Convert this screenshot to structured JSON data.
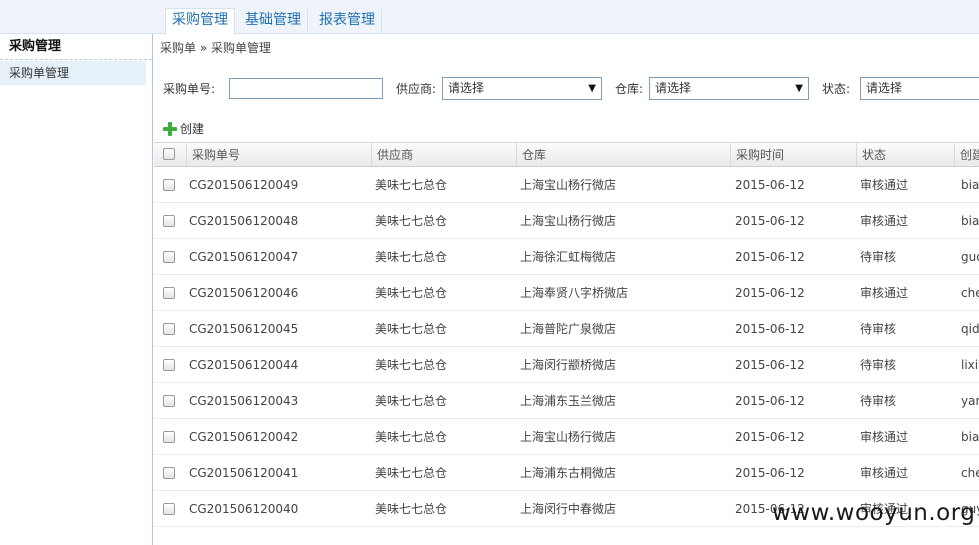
{
  "nav": {
    "tabs": [
      {
        "label": "采购管理",
        "active": true
      },
      {
        "label": "基础管理",
        "active": false
      },
      {
        "label": "报表管理",
        "active": false
      }
    ]
  },
  "sidebar": {
    "title": "采购管理",
    "items": [
      {
        "label": "采购单管理"
      }
    ]
  },
  "breadcrumb": "采购单 » 采购单管理",
  "filters": {
    "order_no_label": "采购单号:",
    "order_no_value": "",
    "supplier_label": "供应商:",
    "supplier_value": "请选择",
    "warehouse_label": "仓库:",
    "warehouse_value": "请选择",
    "status_label": "状态:",
    "status_value": "请选择"
  },
  "toolbar": {
    "create_label": "创建"
  },
  "table": {
    "headers": [
      "采购单号",
      "供应商",
      "仓库",
      "采购时间",
      "状态",
      "创建"
    ],
    "rows": [
      [
        "CG201506120049",
        "美味七七总仓",
        "上海宝山杨行微店",
        "2015-06-12",
        "审核通过",
        "bian"
      ],
      [
        "CG201506120048",
        "美味七七总仓",
        "上海宝山杨行微店",
        "2015-06-12",
        "审核通过",
        "bian"
      ],
      [
        "CG201506120047",
        "美味七七总仓",
        "上海徐汇虹梅微店",
        "2015-06-12",
        "待审核",
        "guo"
      ],
      [
        "CG201506120046",
        "美味七七总仓",
        "上海奉贤八字桥微店",
        "2015-06-12",
        "审核通过",
        "che"
      ],
      [
        "CG201506120045",
        "美味七七总仓",
        "上海普陀广泉微店",
        "2015-06-12",
        "待审核",
        "qid"
      ],
      [
        "CG201506120044",
        "美味七七总仓",
        "上海闵行颛桥微店",
        "2015-06-12",
        "待审核",
        "lixia"
      ],
      [
        "CG201506120043",
        "美味七七总仓",
        "上海浦东玉兰微店",
        "2015-06-12",
        "待审核",
        "yan"
      ],
      [
        "CG201506120042",
        "美味七七总仓",
        "上海宝山杨行微店",
        "2015-06-12",
        "审核通过",
        "bian"
      ],
      [
        "CG201506120041",
        "美味七七总仓",
        "上海浦东古桐微店",
        "2015-06-12",
        "审核通过",
        "che"
      ],
      [
        "CG201506120040",
        "美味七七总仓",
        "上海闵行中春微店",
        "2015-06-12",
        "审核通过",
        "guy"
      ]
    ]
  },
  "watermark": "www.wooyun.org",
  "colors": {
    "accent": "#1f6fb3",
    "nav_bg": "#eef4fa",
    "sidebar_active": "#e6f0f9",
    "plus": "#3cae3c"
  }
}
